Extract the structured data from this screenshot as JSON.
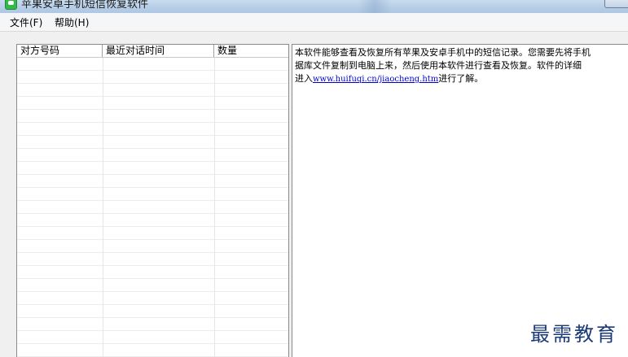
{
  "window": {
    "title": "苹果安卓手机短信恢复软件"
  },
  "menu": {
    "file": "文件(F)",
    "help": "帮助(H)"
  },
  "list": {
    "columns": [
      "对方号码",
      "最近对话时间",
      "数量"
    ],
    "rows": []
  },
  "info": {
    "line1": "本软件能够查看及恢复所有苹果及安卓手机中的短信记录。您需要先将手机",
    "line2": "据库文件复制到电脑上来，然后使用本软件进行查看及恢复。软件的详细",
    "line3_prefix": "进入",
    "link": "www.huifuqi.cn/jiaocheng.htm",
    "line3_suffix": "进行了解。"
  },
  "watermark": "最需教育",
  "icons": {
    "app": "app-icon"
  }
}
